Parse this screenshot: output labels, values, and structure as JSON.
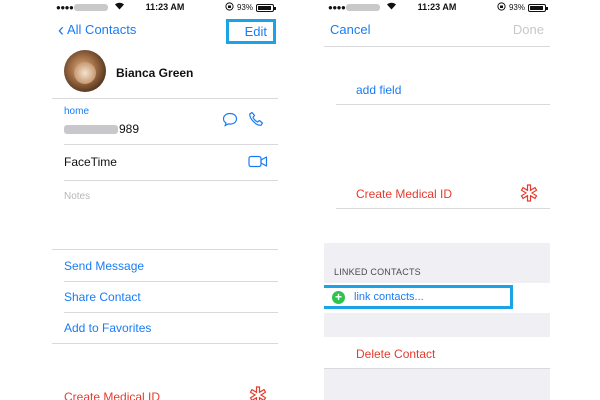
{
  "status_bar": {
    "wifi_icon": "wifi-icon",
    "time": "11:23 AM",
    "battery_percent": "93%",
    "battery_level": 0.93,
    "lock_icon": "lock-rotation-icon"
  },
  "left": {
    "nav": {
      "back_label": "All Contacts",
      "edit_label": "Edit"
    },
    "contact": {
      "name": "Bianca Green"
    },
    "phone": {
      "label": "home",
      "number_visible": "989",
      "message_icon": "message-bubble-icon",
      "call_icon": "phone-icon"
    },
    "facetime": {
      "label": "FaceTime",
      "icon": "video-camera-icon"
    },
    "notes": {
      "placeholder": "Notes"
    },
    "actions": [
      "Send Message",
      "Share Contact",
      "Add to Favorites"
    ],
    "medical": {
      "label": "Create Medical ID",
      "icon": "medical-star-icon"
    }
  },
  "right": {
    "nav": {
      "cancel_label": "Cancel",
      "done_label": "Done"
    },
    "add_field": "add field",
    "medical": {
      "label": "Create Medical ID",
      "icon": "medical-star-icon"
    },
    "linked_header": "LINKED CONTACTS",
    "link_contacts": "link contacts...",
    "delete_label": "Delete Contact"
  },
  "colors": {
    "accent": "#1a7cf5",
    "destructive": "#e53b2f",
    "highlight": "#1aa3e6",
    "add": "#2ec44b"
  }
}
